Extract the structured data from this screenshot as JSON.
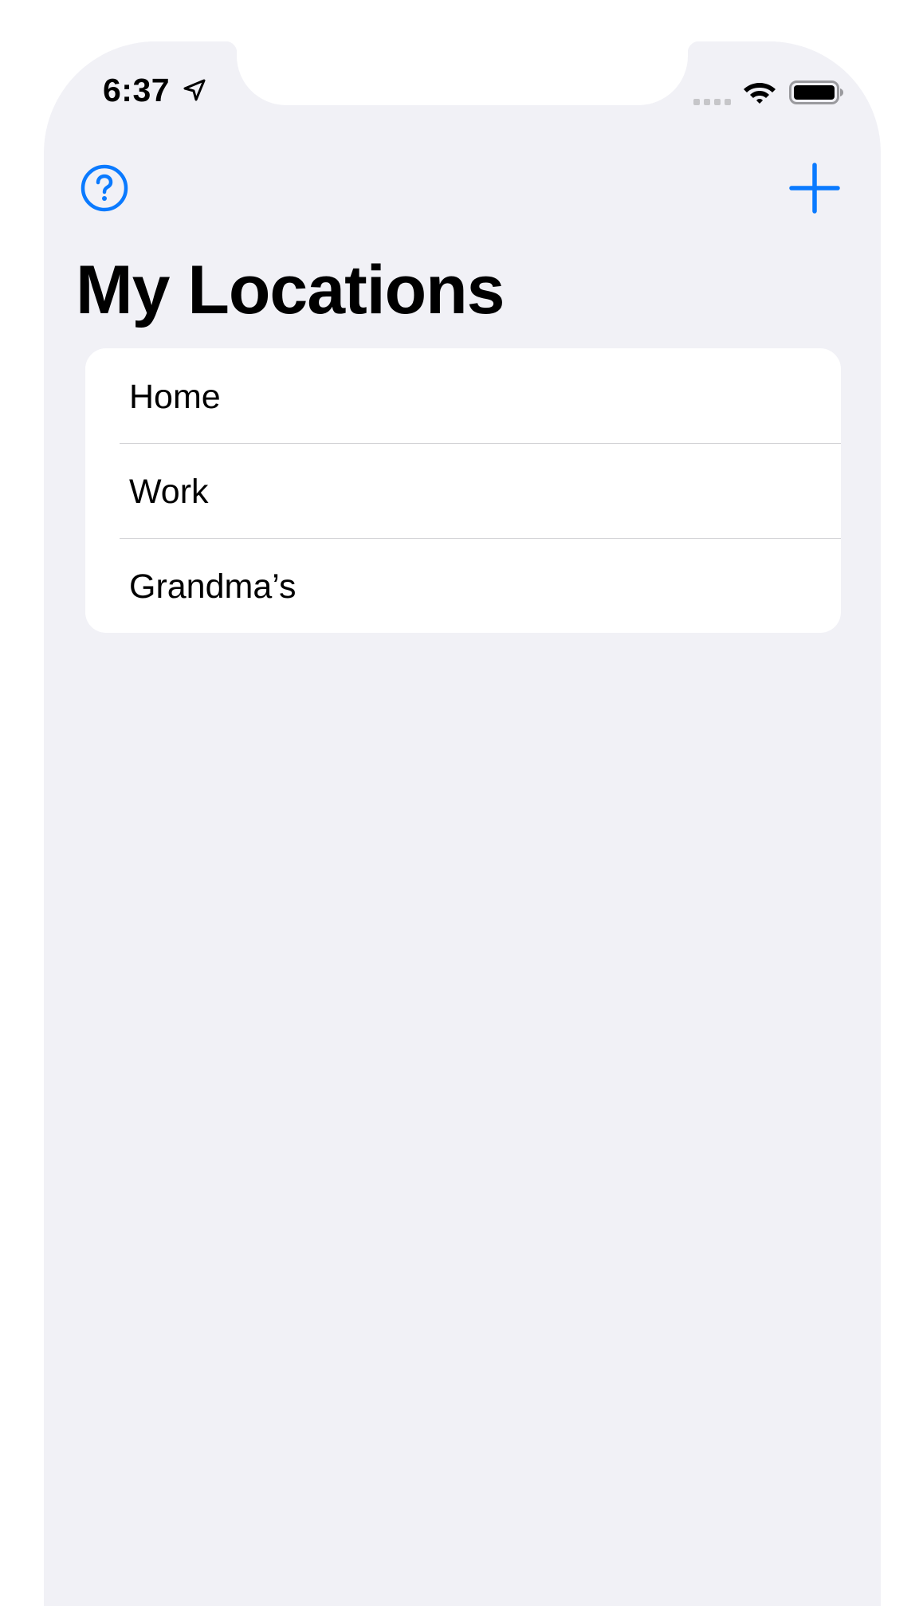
{
  "status_bar": {
    "time": "6:37",
    "location_icon": "location-arrow-icon",
    "signal_icon": "cellular-signal-icon",
    "wifi_icon": "wifi-icon",
    "battery_icon": "battery-icon"
  },
  "nav_bar": {
    "help_icon": "question-circle-icon",
    "add_icon": "plus-icon",
    "title": "My Locations"
  },
  "locations": [
    {
      "label": "Home"
    },
    {
      "label": "Work"
    },
    {
      "label": "Grandma’s"
    }
  ],
  "colors": {
    "accent": "#0a7aff",
    "background": "#f1f1f6",
    "card": "#ffffff",
    "separator": "#d3d3d6"
  }
}
